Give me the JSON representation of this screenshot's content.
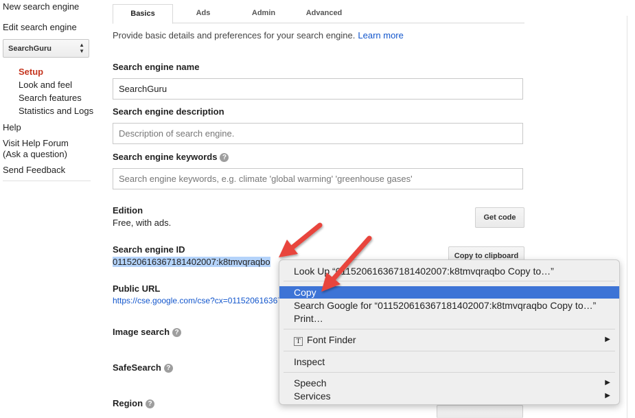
{
  "sidebar": {
    "new_engine": "New search engine",
    "edit_engine": "Edit search engine",
    "selected_engine": "SearchGuru",
    "items": [
      {
        "label": "Setup"
      },
      {
        "label": "Look and feel"
      },
      {
        "label": "Search features"
      },
      {
        "label": "Statistics and Logs"
      }
    ],
    "help": "Help",
    "forum_line1": "Visit Help Forum",
    "forum_line2": "(Ask a question)",
    "feedback": "Send Feedback"
  },
  "tabs": [
    {
      "label": "Basics"
    },
    {
      "label": "Ads"
    },
    {
      "label": "Admin"
    },
    {
      "label": "Advanced"
    }
  ],
  "intro": {
    "text": "Provide basic details and preferences for your search engine.",
    "link": "Learn more"
  },
  "form": {
    "name_label": "Search engine name",
    "name_value": "SearchGuru",
    "description_label": "Search engine description",
    "description_placeholder": "Description of search engine.",
    "keywords_label": "Search engine keywords",
    "keywords_placeholder": "Search engine keywords, e.g. climate 'global warming' 'greenhouse gases'",
    "edition_label": "Edition",
    "edition_value": "Free, with ads.",
    "get_code": "Get code",
    "id_label": "Search engine ID",
    "id_value": "011520616367181402007:k8tmvqraqbo",
    "copy_clipboard": "Copy to clipboard",
    "public_url_label": "Public URL",
    "public_url_value": "https://cse.google.com/cse?cx=011520616367181402007:k8tmvqraqbo",
    "image_search_label": "Image search",
    "safesearch_label": "SafeSearch",
    "region_label": "Region"
  },
  "context_menu": {
    "look_up": "Look Up “011520616367181402007:k8tmvqraqbo Copy to…”",
    "copy": "Copy",
    "search_google": "Search Google for “011520616367181402007:k8tmvqraqbo Copy to…”",
    "print": "Print…",
    "font_finder": "Font Finder",
    "inspect": "Inspect",
    "speech": "Speech",
    "services": "Services"
  },
  "colors": {
    "accent_setup": "#c5361f",
    "link": "#1155cc",
    "highlight": "#3d74d6",
    "arrow": "#e8453c"
  }
}
